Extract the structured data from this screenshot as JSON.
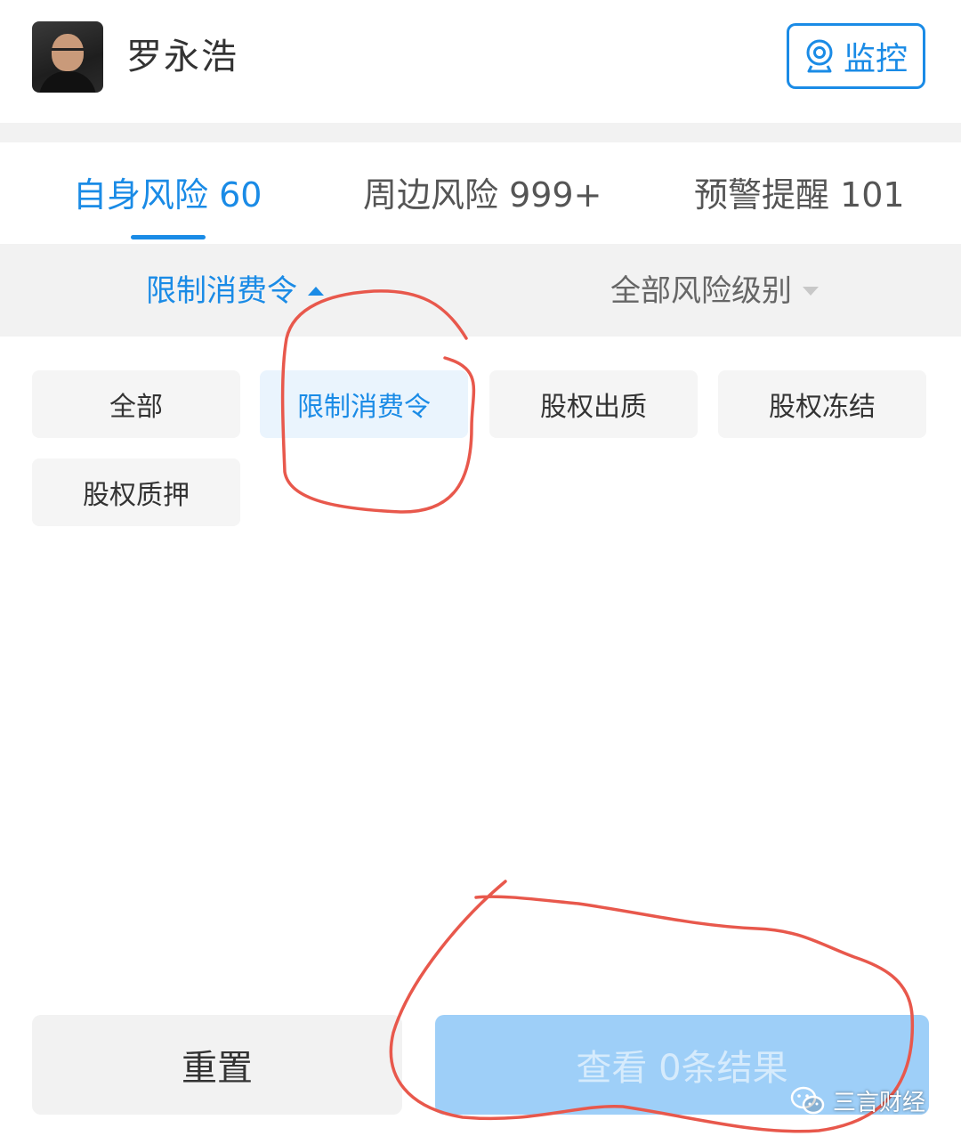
{
  "header": {
    "name": "罗永浩",
    "monitor_label": "监控"
  },
  "tabs": [
    {
      "label": "自身风险 60",
      "active": true
    },
    {
      "label": "周边风险 999+",
      "active": false
    },
    {
      "label": "预警提醒 101",
      "active": false
    }
  ],
  "filters": {
    "type_label": "限制消费令",
    "level_label": "全部风险级别"
  },
  "chips": [
    {
      "label": "全部",
      "selected": false
    },
    {
      "label": "限制消费令",
      "selected": true
    },
    {
      "label": "股权出质",
      "selected": false
    },
    {
      "label": "股权冻结",
      "selected": false
    },
    {
      "label": "股权质押",
      "selected": false
    }
  ],
  "footer": {
    "reset_label": "重置",
    "view_label": "查看 0条结果"
  },
  "watermark": {
    "text": "三言财经"
  },
  "colors": {
    "accent": "#1a8be6",
    "annotation": "#e8584c",
    "view_button_bg": "#9ecff8"
  },
  "icons": {
    "monitor": "camera-icon",
    "type_filter_arrow": "triangle-up-icon",
    "level_filter_arrow": "triangle-down-icon",
    "watermark": "wechat-icon"
  }
}
